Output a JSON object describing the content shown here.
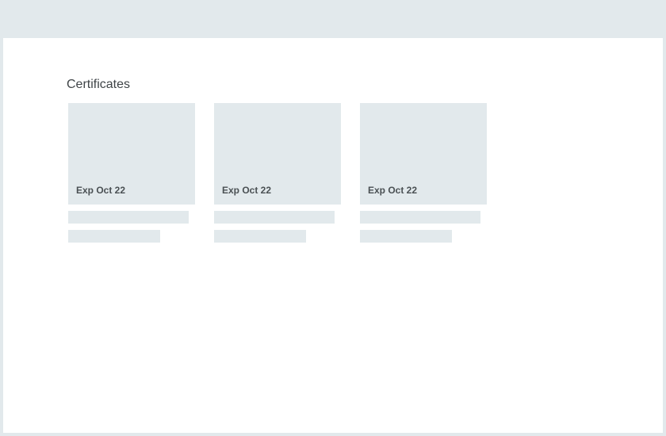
{
  "section": {
    "title": "Certificates"
  },
  "certificates": [
    {
      "expiry": "Exp Oct 22"
    },
    {
      "expiry": "Exp Oct 22"
    },
    {
      "expiry": "Exp Oct 22"
    }
  ],
  "colors": {
    "background": "#e2e9ec",
    "panel": "#ffffff",
    "placeholder": "#e2e9ec",
    "title_text": "#3f4447",
    "expiry_text": "#4a5053"
  }
}
